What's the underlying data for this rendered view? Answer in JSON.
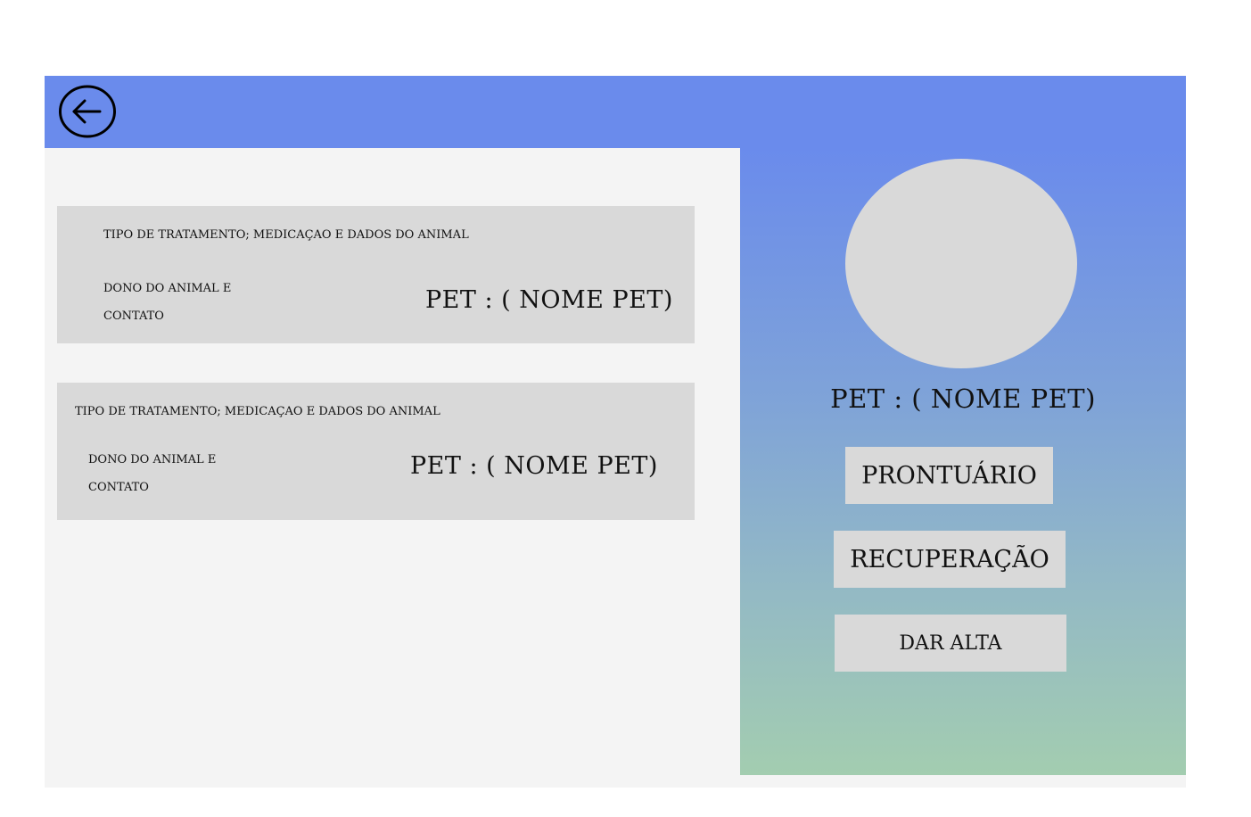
{
  "header": {
    "back_icon": "back-arrow-circle-icon"
  },
  "records": [
    {
      "treatment": "TIPO DE TRATAMENTO; MEDICAÇAO E DADOS DO ANIMAL",
      "owner": "DONO DO ANIMAL E CONTATO",
      "pet": "PET : ( NOME PET)"
    },
    {
      "treatment": "TIPO DE TRATAMENTO; MEDICAÇAO E DADOS DO ANIMAL",
      "owner": "DONO DO ANIMAL E CONTATO",
      "pet": "PET : ( NOME PET)"
    }
  ],
  "sidebar": {
    "pet_name": "PET : ( NOME PET)",
    "prontuario_label": "PRONTUÁRIO",
    "recuperacao_label": "RECUPERAÇÃO",
    "dar_alta_label": "DAR ALTA"
  },
  "colors": {
    "header": "#6a8bec",
    "gradient_end": "#a3cdb0",
    "card": "#d9d9d9",
    "background": "#f4f4f4"
  }
}
